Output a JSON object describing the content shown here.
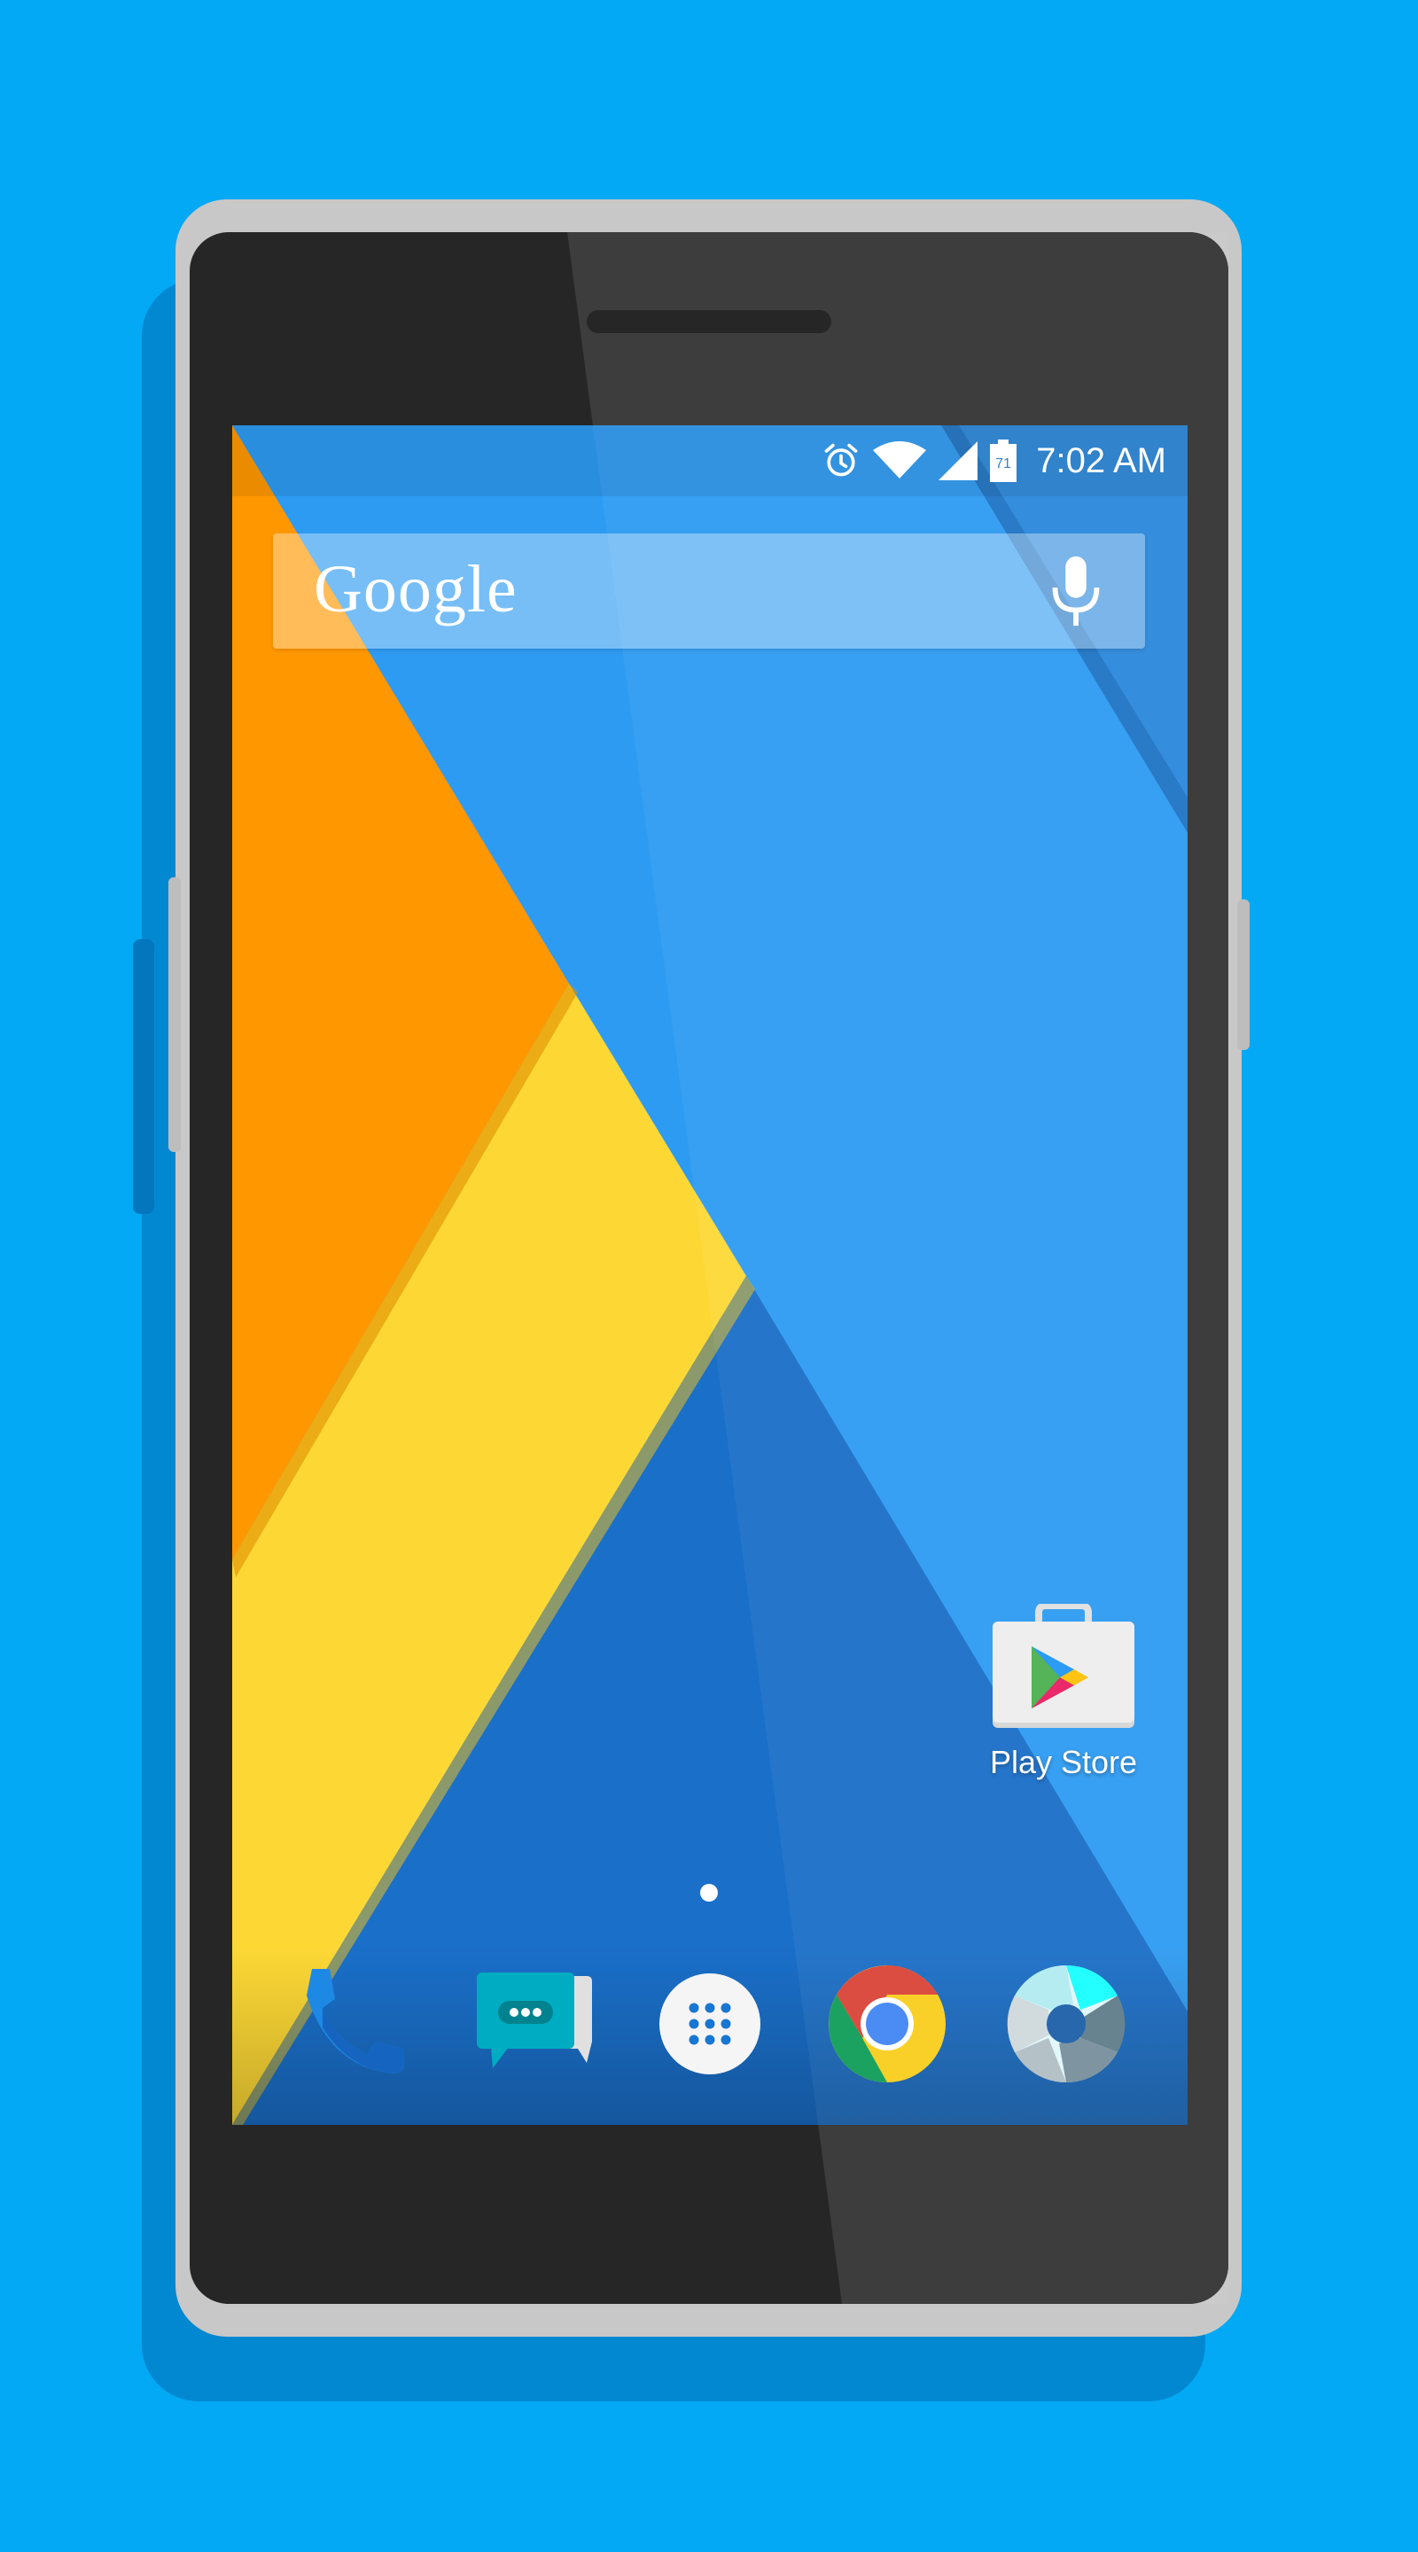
{
  "status_bar": {
    "time": "7:02 AM",
    "battery_level": "71",
    "icons": [
      "alarm-icon",
      "wifi-icon",
      "cell-signal-icon",
      "battery-icon"
    ]
  },
  "search": {
    "logo": "Google",
    "icon": "mic-icon"
  },
  "home": {
    "apps": [
      {
        "label": "Play Store",
        "icon": "play-store-icon"
      }
    ],
    "page_count": 1,
    "current_page": 1
  },
  "dock": {
    "items": [
      {
        "icon": "phone-icon"
      },
      {
        "icon": "messaging-icon"
      },
      {
        "icon": "app-drawer-icon"
      },
      {
        "icon": "chrome-icon"
      },
      {
        "icon": "camera-icon"
      }
    ]
  },
  "colors": {
    "background": "#03a9f4",
    "wallpaper_blue": "#2196f3",
    "wallpaper_dark_blue": "#1565c0",
    "wallpaper_orange": "#ff9800",
    "wallpaper_yellow": "#fdd835"
  }
}
